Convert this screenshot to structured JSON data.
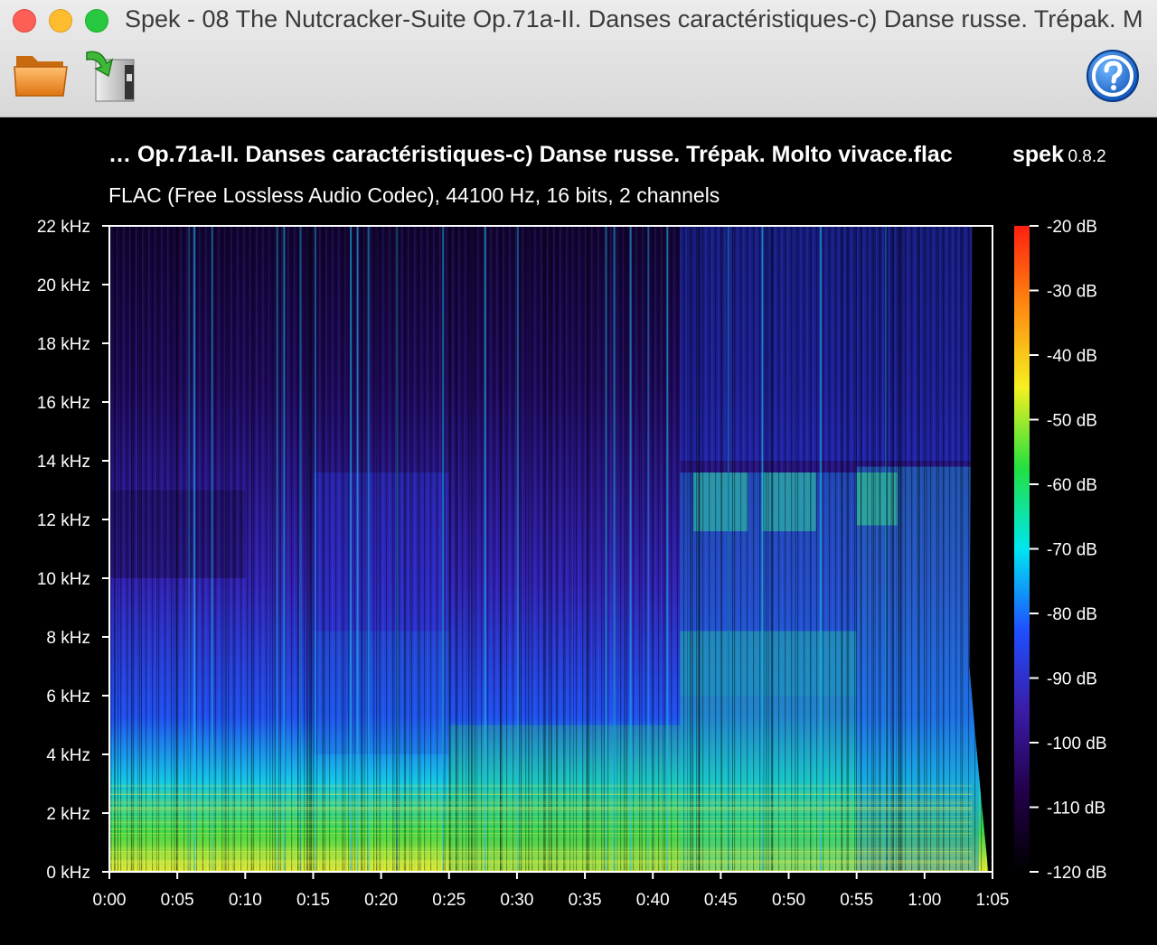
{
  "window": {
    "title": "Spek - 08 The Nutcracker-Suite Op.71a-II. Danses caractéristiques-c) Danse russe. Trépak. M…"
  },
  "toolbar": {
    "open_icon": "folder-icon",
    "save_icon": "save-export-icon",
    "help_icon": "help-icon"
  },
  "header": {
    "file_title": "… Op.71a-II. Danses caractéristiques-c) Danse russe. Trépak. Molto vivace.flac",
    "brand_name": "spek",
    "brand_version": "0.8.2",
    "file_info": "FLAC (Free Lossless Audio Codec), 44100 Hz, 16 bits, 2 channels"
  },
  "chart_data": {
    "type": "heatmap",
    "x_axis": {
      "ticks": [
        "0:00",
        "0:05",
        "0:10",
        "0:15",
        "0:20",
        "0:25",
        "0:30",
        "0:35",
        "0:40",
        "0:45",
        "0:50",
        "0:55",
        "1:00",
        "1:05"
      ],
      "range_seconds": [
        0,
        65
      ]
    },
    "y_axis": {
      "ticks": [
        "0 kHz",
        "2 kHz",
        "4 kHz",
        "6 kHz",
        "8 kHz",
        "10 kHz",
        "12 kHz",
        "14 kHz",
        "16 kHz",
        "18 kHz",
        "20 kHz",
        "22 kHz"
      ],
      "range_khz": [
        0,
        22
      ]
    },
    "colorbar": {
      "ticks": [
        "-20 dB",
        "-30 dB",
        "-40 dB",
        "-50 dB",
        "-60 dB",
        "-70 dB",
        "-80 dB",
        "-90 dB",
        "-100 dB",
        "-110 dB",
        "-120 dB"
      ],
      "range_db": [
        -120,
        -20
      ],
      "colors": [
        "#000000",
        "#22004a",
        "#3a1ca8",
        "#1f4fff",
        "#00e6f0",
        "#22e040",
        "#f5f020",
        "#ff8a10",
        "#ff2010"
      ]
    },
    "audio_end_seconds": 63.5
  }
}
